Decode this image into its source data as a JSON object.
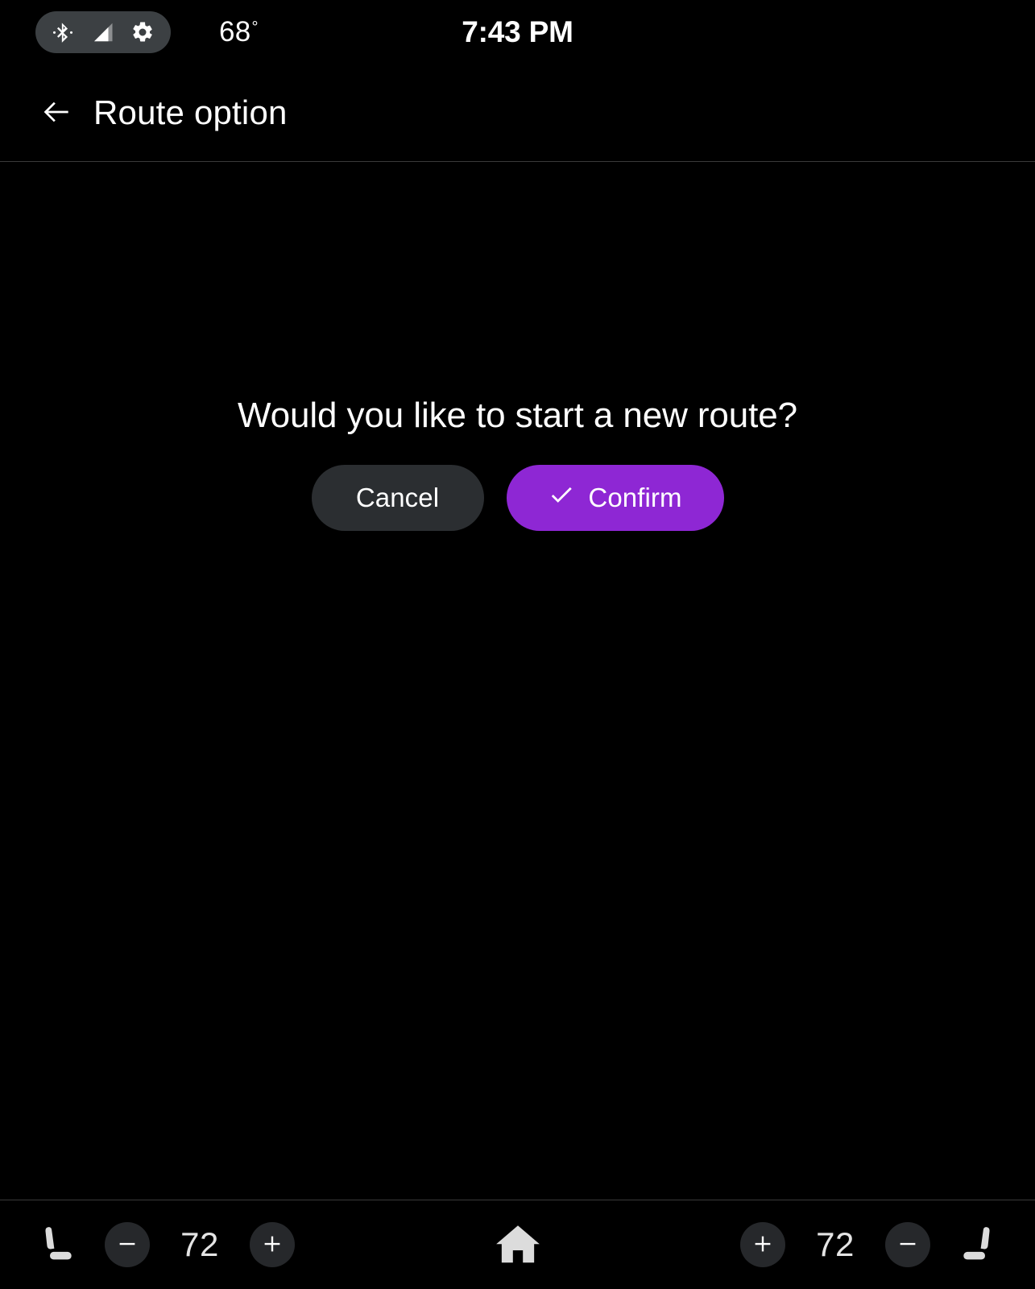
{
  "status_bar": {
    "bluetooth_icon": "bluetooth-icon",
    "signal_icon": "signal-strength-icon",
    "settings_icon": "gear-icon",
    "temperature": "68",
    "degree_symbol": "°",
    "clock": "7:43 PM"
  },
  "header": {
    "back_icon": "back-arrow-icon",
    "title": "Route option"
  },
  "dialog": {
    "message": "Would you like to start a new route?",
    "cancel_label": "Cancel",
    "confirm_label": "Confirm",
    "confirm_icon": "check-icon",
    "confirm_color": "#8E27D4",
    "cancel_color": "#2B2E31"
  },
  "bottom_bar": {
    "left": {
      "seat_icon": "car-seat-icon",
      "decrease_icon": "minus-icon",
      "temperature": "72",
      "increase_icon": "plus-icon"
    },
    "home_icon": "home-icon",
    "right": {
      "increase_icon": "plus-icon",
      "temperature": "72",
      "decrease_icon": "minus-icon",
      "seat_icon": "car-seat-icon"
    }
  }
}
